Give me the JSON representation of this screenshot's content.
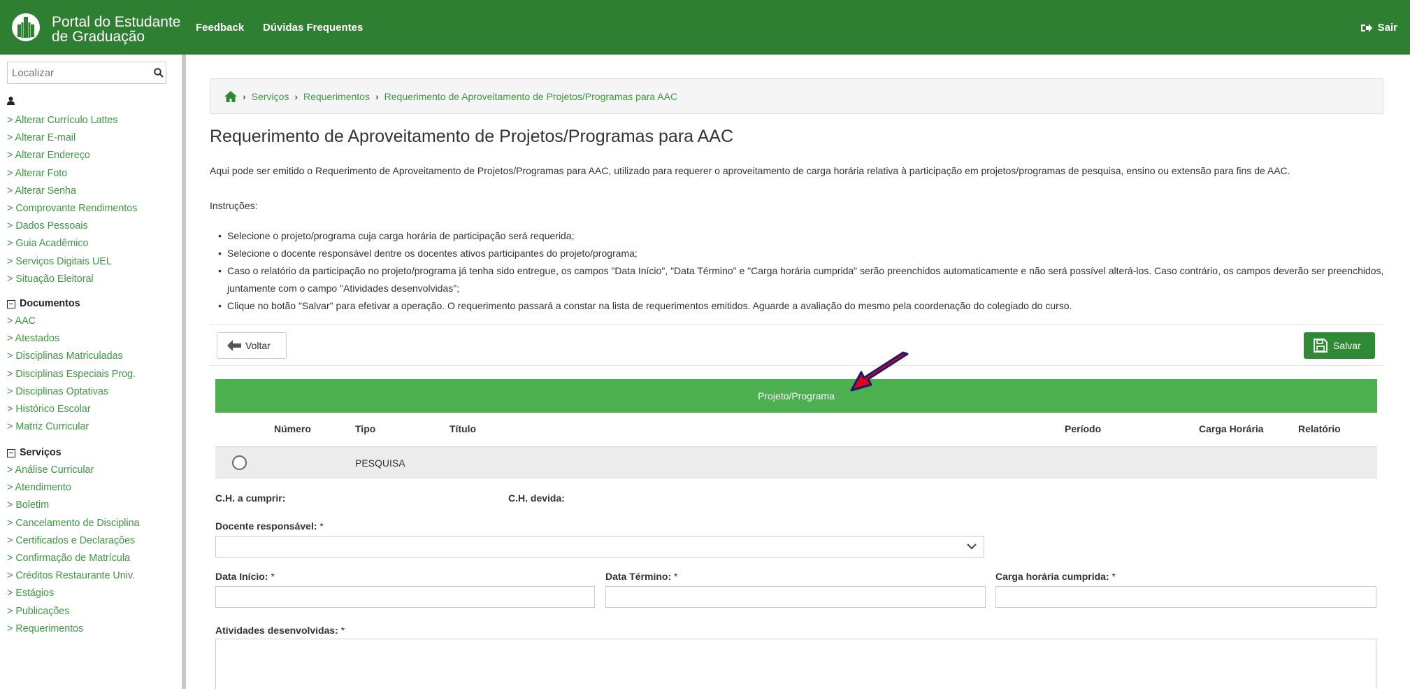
{
  "header": {
    "portal_title_line1": "Portal do Estudante",
    "portal_title_line2": "de Graduação",
    "nav": [
      "Feedback",
      "Dúvidas Frequentes"
    ],
    "logout_label": "Sair"
  },
  "sidebar": {
    "search_placeholder": "Localizar",
    "user_links": [
      "> Alterar Currículo Lattes",
      "> Alterar E-mail",
      "> Alterar Endereço",
      "> Alterar Foto",
      "> Alterar Senha",
      "> Comprovante Rendimentos",
      "> Dados Pessoais",
      "> Guia Acadêmico",
      "> Serviços Digitais UEL",
      "> Situação Eleitoral"
    ],
    "documentos_heading": "Documentos",
    "documentos_links": [
      "> AAC",
      "> Atestados",
      "> Disciplinas Matriculadas",
      "> Disciplinas Especiais Prog.",
      "> Disciplinas Optativas",
      "> Histórico Escolar",
      "> Matriz Curricular"
    ],
    "servicos_heading": "Serviços",
    "servicos_links": [
      "> Análise Curricular",
      "> Atendimento",
      "> Boletim",
      "> Cancelamento de Disciplina",
      "> Certificados e Declarações",
      "> Confirmação de Matrícula",
      "> Créditos Restaurante Univ.",
      "> Estágios",
      "> Publicações",
      "> Requerimentos"
    ]
  },
  "breadcrumb": [
    "Serviços",
    "Requerimentos",
    "Requerimento de Aproveitamento de Projetos/Programas para AAC"
  ],
  "page": {
    "title": "Requerimento de Aproveitamento de Projetos/Programas para AAC",
    "intro": "Aqui pode ser emitido o Requerimento de Aproveitamento de Projetos/Programas para AAC, utilizado para requerer o aproveitamento de carga horária relativa à participação em projetos/programas de pesquisa, ensino ou extensão para fins de AAC.",
    "instructions_label": "Instruções:",
    "instructions": [
      "Selecione o projeto/programa cuja carga horária de participação será requerida;",
      "Selecione o docente responsável dentre os docentes ativos participantes do projeto/programa;",
      "Caso o relatório da participação no projeto/programa já tenha sido entregue, os campos \"Data Início\", \"Data Término\" e \"Carga horária cumprida\" serão preenchidos automaticamente e não será possível alterá-los. Caso contrário, os campos deverão ser preenchidos, juntamente com o campo \"Atividades desenvolvidas\";",
      "Clique no botão \"Salvar\" para efetivar a operação. O requerimento passará a constar na lista de requerimentos emitidos. Aguarde a avaliação do mesmo pela coordenação do colegiado do curso."
    ]
  },
  "toolbar": {
    "back_label": "Voltar",
    "save_label": "Salvar"
  },
  "projects": {
    "header": "Projeto/Programa",
    "columns": [
      "Número",
      "Tipo",
      "Título",
      "Período",
      "Carga Horária",
      "Relatório"
    ],
    "rows": [
      {
        "numero": "",
        "tipo": "PESQUISA",
        "titulo": "",
        "periodo": "",
        "carga": "",
        "relatorio": ""
      }
    ]
  },
  "form": {
    "ch_a_cumprir_label": "C.H. a cumprir:",
    "ch_devida_label": "C.H. devida:",
    "docente_label": "Docente responsável:",
    "data_inicio_label": "Data Início:",
    "data_termino_label": "Data Término:",
    "carga_cumprida_label": "Carga horária cumprida:",
    "atividades_label": "Atividades desenvolvidas:",
    "required_mark": "*"
  },
  "colors": {
    "header_green": "#2f7f32",
    "link_green": "#3a9a3e",
    "table_green": "#4caf50",
    "annotation_arrow": "#e0001b"
  }
}
